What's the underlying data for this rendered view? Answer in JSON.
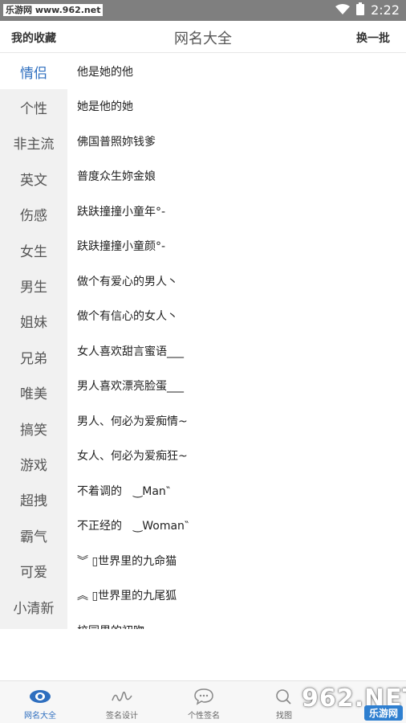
{
  "status_bar": {
    "watermark": "乐游网 www.962.net",
    "time": "2:22"
  },
  "header": {
    "left_label": "我的收藏",
    "title": "网名大全",
    "right_label": "换一批"
  },
  "sidebar": {
    "items": [
      {
        "label": "情侣",
        "active": true
      },
      {
        "label": "个性"
      },
      {
        "label": "非主流"
      },
      {
        "label": "英文"
      },
      {
        "label": "伤感"
      },
      {
        "label": "女生"
      },
      {
        "label": "男生"
      },
      {
        "label": "姐妹"
      },
      {
        "label": "兄弟"
      },
      {
        "label": "唯美"
      },
      {
        "label": "搞笑"
      },
      {
        "label": "游戏"
      },
      {
        "label": "超拽"
      },
      {
        "label": "霸气"
      },
      {
        "label": "可爱"
      },
      {
        "label": "小清新"
      }
    ]
  },
  "names": [
    "他是她的他",
    "她是他的她",
    "佛国普照妳钱爹",
    "普度众生妳金娘",
    "趺趺撞撞小童年°-",
    "趺趺撞撞小童颜°-",
    "做个有爱心的男人丶",
    "做个有信心的女人丶",
    "女人喜欢甜言蜜语___",
    "男人喜欢漂亮脸蛋___",
    "男人、何必为爱痴情~",
    "女人、何必为爱痴狂~",
    "不着调的　‿Man‶",
    "不正经的　‿Woman‶",
    "︾ ▯世界里的九命猫",
    "︽ ▯世界里的九尾狐",
    "校园里的初吻、"
  ],
  "bottom_nav": {
    "tabs": [
      {
        "label": "网名大全",
        "icon": "eye-icon",
        "active": true
      },
      {
        "label": "签名设计",
        "icon": "signature-icon"
      },
      {
        "label": "个性签名",
        "icon": "chat-bubble-icon"
      },
      {
        "label": "找图",
        "icon": "search-icon"
      }
    ]
  },
  "corner_watermark": {
    "logo": "962.NET",
    "badge": "乐游网"
  },
  "colors": {
    "accent": "#2f6fbf",
    "status_bar": "#7f7f7f",
    "sidebar_bg": "#f1f1f1"
  }
}
